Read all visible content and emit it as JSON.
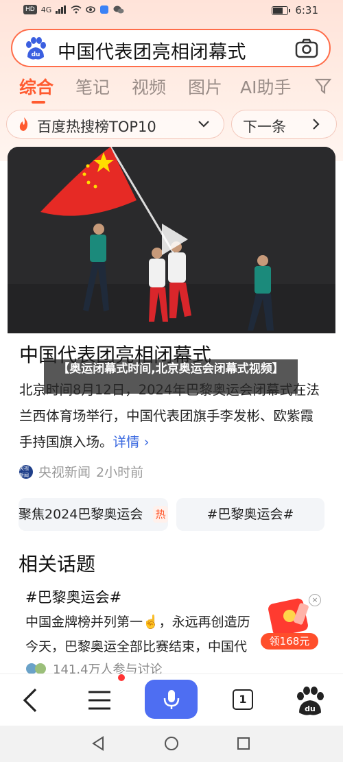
{
  "status_bar": {
    "hd_label": "HD",
    "network": "4G",
    "time": "6:31"
  },
  "search": {
    "query": "中国代表团亮相闭幕式"
  },
  "tabs": [
    {
      "label": "综合"
    },
    {
      "label": "笔记"
    },
    {
      "label": "视频"
    },
    {
      "label": "图片"
    },
    {
      "label": "AI助手"
    }
  ],
  "hot_bar": {
    "title": "百度热搜榜TOP10",
    "next_label": "下一条"
  },
  "article": {
    "headline": "中国代表团亮相闭幕式",
    "summary": "北京时间8月12日，2024年巴黎奥运会闭幕式在法兰西体育场举行，中国代表团旗手李发彬、欧紫霞手持国旗入场。",
    "detail_link": "详情",
    "source": "央视新闻",
    "source_avatar": "央视新闻",
    "time_ago": "2小时前",
    "chips": [
      {
        "label": "聚焦2024巴黎奥运会",
        "tag": "热"
      },
      {
        "label": "#巴黎奥运会#"
      }
    ]
  },
  "overlay_caption": "【奥运闭幕式时间,北京奥运会闭幕式视频】",
  "related": {
    "title": "相关话题",
    "topic": "#巴黎奥运会#",
    "lines": [
      "中国金牌榜并列第一☝️，永远再创造历",
      "今天，巴黎奥运全部比赛结束，中国代"
    ],
    "stats": "141.4万人参与讨论"
  },
  "red_packet": {
    "label": "领168元"
  },
  "bottom_nav": {
    "tab_count": "1"
  },
  "colors": {
    "accent": "#ff5a2f",
    "mic_blue": "#4e6ef2",
    "link_blue": "#3a69e0"
  }
}
